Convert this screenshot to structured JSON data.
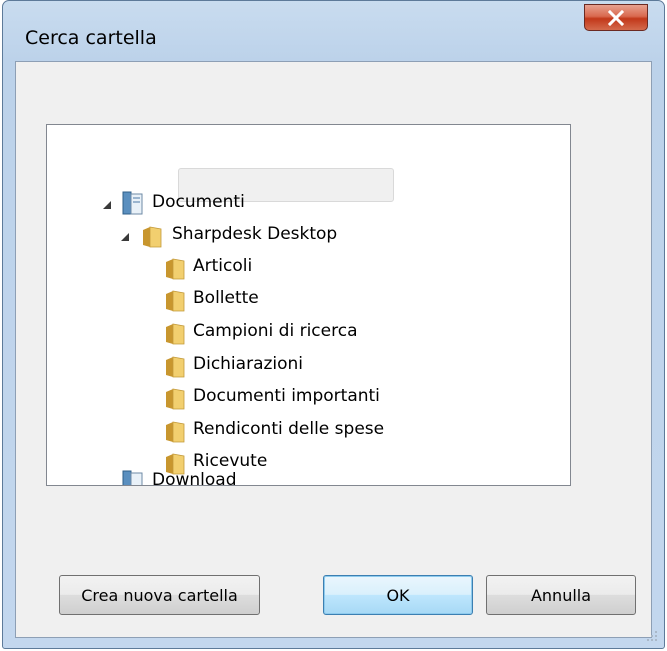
{
  "window": {
    "title": "Cerca cartella",
    "close_icon": "close-icon"
  },
  "tree": {
    "items": [
      {
        "label": "Documenti",
        "icon": "library-icon",
        "expanded": true
      },
      {
        "label": "Sharpdesk Desktop",
        "icon": "folder-icon",
        "expanded": true,
        "selected": true
      },
      {
        "label": "Articoli",
        "icon": "folder-icon"
      },
      {
        "label": "Bollette",
        "icon": "folder-icon"
      },
      {
        "label": "Campioni di ricerca",
        "icon": "folder-icon"
      },
      {
        "label": "Dichiarazioni",
        "icon": "folder-icon"
      },
      {
        "label": "Documenti importanti",
        "icon": "folder-icon"
      },
      {
        "label": "Rendiconti delle spese",
        "icon": "folder-icon"
      },
      {
        "label": "Ricevute",
        "icon": "folder-icon"
      },
      {
        "label": "Download",
        "icon": "library-icon"
      }
    ]
  },
  "buttons": {
    "new_folder": "Crea nuova cartella",
    "ok": "OK",
    "cancel": "Annulla"
  },
  "colors": {
    "close_red": "#c2381a",
    "ok_border": "#3c7fb1",
    "folder": "#e8b84a"
  }
}
